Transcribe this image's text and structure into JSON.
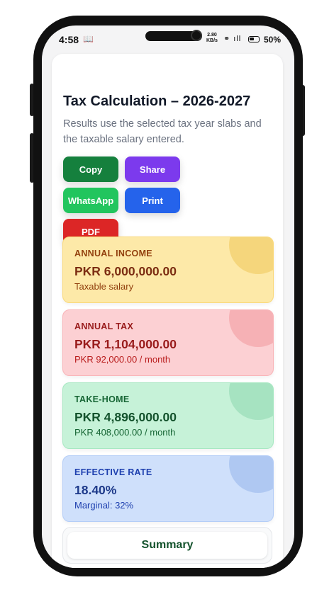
{
  "status_bar": {
    "time": "4:58",
    "notification_icon": "book-icon",
    "speed_value": "2.80",
    "speed_unit": "KB/s",
    "battery_percent": "50%",
    "battery_level": 0.5
  },
  "header": {
    "title": "Tax Calculation – 2026-2027",
    "subtitle": "Results use the selected tax year slabs and the taxable salary entered."
  },
  "actions": [
    {
      "label": "Copy",
      "color": "#15803d"
    },
    {
      "label": "Share",
      "color": "#7c3aed"
    },
    {
      "label": "WhatsApp",
      "color": "#22c55e"
    },
    {
      "label": "Print",
      "color": "#2563eb"
    },
    {
      "label": "PDF",
      "color": "#dc2626"
    }
  ],
  "cards": {
    "annual_income": {
      "label": "ANNUAL INCOME",
      "value": "PKR 6,000,000.00",
      "sub": "Taxable salary"
    },
    "annual_tax": {
      "label": "ANNUAL TAX",
      "value": "PKR 1,104,000.00",
      "sub": "PKR 92,000.00 / month"
    },
    "take_home": {
      "label": "TAKE-HOME",
      "value": "PKR 4,896,000.00",
      "sub": "PKR 408,000.00 / month"
    },
    "effective_rate": {
      "label": "EFFECTIVE RATE",
      "value": "18.40%",
      "sub": "Marginal: 32%"
    }
  },
  "summary_button": {
    "label": "Summary"
  }
}
